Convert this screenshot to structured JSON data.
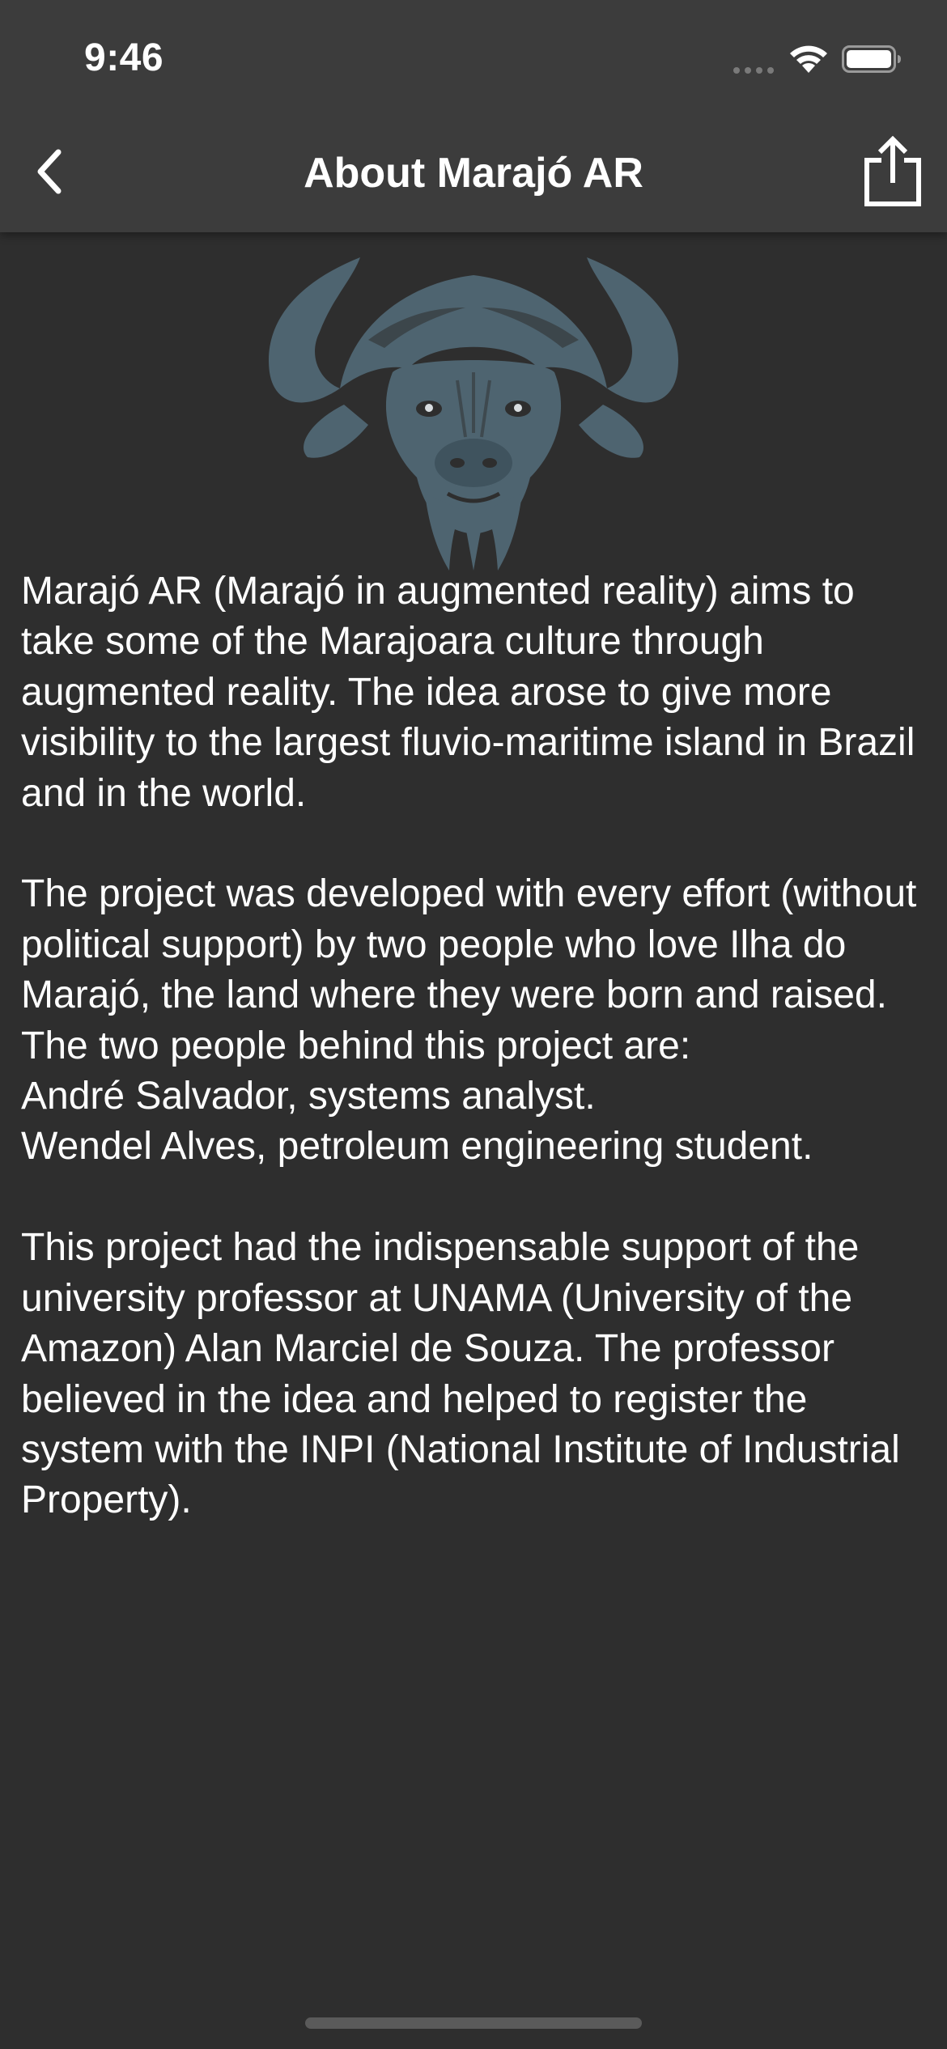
{
  "status_bar": {
    "time": "9:46"
  },
  "nav": {
    "title": "About Marajó AR",
    "back_icon": "chevron-left-icon",
    "share_icon": "share-icon"
  },
  "logo": {
    "icon": "buffalo-head-logo",
    "color": "#4e6470"
  },
  "about": {
    "paragraph_1": "Marajó AR (Marajó in augmented reality) aims to take some of the Marajoara culture through augmented reality. The idea arose to give more visibility to the largest fluvio-maritime island in Brazil and in the world.",
    "paragraph_2": "The project was developed with every effort (without political support) by two people who love Ilha do Marajó, the land where they were born and raised.\nThe two people behind this project are:\nAndré Salvador, systems analyst.\nWendel Alves, petroleum engineering student.",
    "paragraph_3": "This project had the indispensable support of the university professor at UNAMA (University of the Amazon) Alan Marciel de Souza. The professor believed in the idea and helped to register the system with the INPI (National Institute of Industrial Property)."
  },
  "colors": {
    "background": "#2e2e2e",
    "header": "#3c3c3c",
    "text": "#ffffff"
  }
}
